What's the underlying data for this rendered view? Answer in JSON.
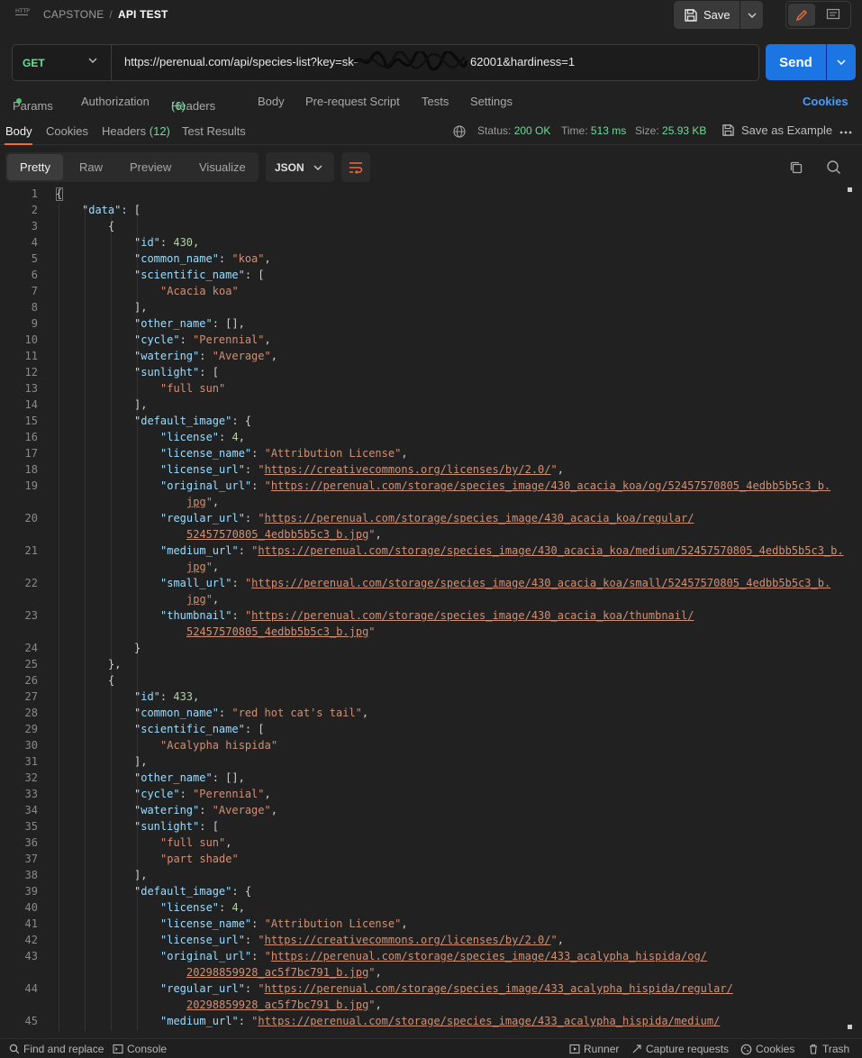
{
  "header": {
    "app_icon": "http-file-icon",
    "app_icon_text": "HTTP",
    "breadcrumb_collection": "CAPSTONE",
    "breadcrumb_separator": "/",
    "breadcrumb_request": "API TEST",
    "save_label": "Save"
  },
  "request": {
    "method": "GET",
    "url": "https://perenual.com/api/species-list?key=sk-",
    "url_tail": "62001&hardiness=1",
    "send_label": "Send"
  },
  "request_tabs": {
    "params": "Params",
    "authorization": "Authorization",
    "headers": "Headers",
    "headers_count": "(6)",
    "body": "Body",
    "prerequest": "Pre-request Script",
    "tests": "Tests",
    "settings": "Settings",
    "cookies": "Cookies"
  },
  "response_tabs": {
    "body": "Body",
    "cookies": "Cookies",
    "headers": "Headers",
    "headers_count": "(12)",
    "test_results": "Test Results"
  },
  "response_meta": {
    "status_label": "Status:",
    "status_value": "200 OK",
    "time_label": "Time:",
    "time_value": "513 ms",
    "size_label": "Size:",
    "size_value": "25.93 KB",
    "save_example": "Save as Example"
  },
  "viewer": {
    "modes": [
      "Pretty",
      "Raw",
      "Preview",
      "Visualize"
    ],
    "format": "JSON"
  },
  "code_lines": [
    {
      "n": "1",
      "indent": 0,
      "parts": [
        [
          "p",
          "{"
        ]
      ]
    },
    {
      "n": "2",
      "indent": 1,
      "parts": [
        [
          "k",
          "\"data\""
        ],
        [
          "p",
          ": ["
        ]
      ]
    },
    {
      "n": "3",
      "indent": 2,
      "parts": [
        [
          "p",
          "{"
        ]
      ]
    },
    {
      "n": "4",
      "indent": 3,
      "parts": [
        [
          "k",
          "\"id\""
        ],
        [
          "p",
          ": "
        ],
        [
          "n",
          "430"
        ],
        [
          "p",
          ","
        ]
      ]
    },
    {
      "n": "5",
      "indent": 3,
      "parts": [
        [
          "k",
          "\"common_name\""
        ],
        [
          "p",
          ": "
        ],
        [
          "s",
          "\"koa\""
        ],
        [
          "p",
          ","
        ]
      ]
    },
    {
      "n": "6",
      "indent": 3,
      "parts": [
        [
          "k",
          "\"scientific_name\""
        ],
        [
          "p",
          ": ["
        ]
      ]
    },
    {
      "n": "7",
      "indent": 4,
      "parts": [
        [
          "s",
          "\"Acacia koa\""
        ]
      ]
    },
    {
      "n": "8",
      "indent": 3,
      "parts": [
        [
          "p",
          "],"
        ]
      ]
    },
    {
      "n": "9",
      "indent": 3,
      "parts": [
        [
          "k",
          "\"other_name\""
        ],
        [
          "p",
          ": [],"
        ]
      ]
    },
    {
      "n": "10",
      "indent": 3,
      "parts": [
        [
          "k",
          "\"cycle\""
        ],
        [
          "p",
          ": "
        ],
        [
          "s",
          "\"Perennial\""
        ],
        [
          "p",
          ","
        ]
      ]
    },
    {
      "n": "11",
      "indent": 3,
      "parts": [
        [
          "k",
          "\"watering\""
        ],
        [
          "p",
          ": "
        ],
        [
          "s",
          "\"Average\""
        ],
        [
          "p",
          ","
        ]
      ]
    },
    {
      "n": "12",
      "indent": 3,
      "parts": [
        [
          "k",
          "\"sunlight\""
        ],
        [
          "p",
          ": ["
        ]
      ]
    },
    {
      "n": "13",
      "indent": 4,
      "parts": [
        [
          "s",
          "\"full sun\""
        ]
      ]
    },
    {
      "n": "14",
      "indent": 3,
      "parts": [
        [
          "p",
          "],"
        ]
      ]
    },
    {
      "n": "15",
      "indent": 3,
      "parts": [
        [
          "k",
          "\"default_image\""
        ],
        [
          "p",
          ": {"
        ]
      ]
    },
    {
      "n": "16",
      "indent": 4,
      "parts": [
        [
          "k",
          "\"license\""
        ],
        [
          "p",
          ": "
        ],
        [
          "n",
          "4"
        ],
        [
          "p",
          ","
        ]
      ]
    },
    {
      "n": "17",
      "indent": 4,
      "parts": [
        [
          "k",
          "\"license_name\""
        ],
        [
          "p",
          ": "
        ],
        [
          "s",
          "\"Attribution License\""
        ],
        [
          "p",
          ","
        ]
      ]
    },
    {
      "n": "18",
      "indent": 4,
      "parts": [
        [
          "k",
          "\"license_url\""
        ],
        [
          "p",
          ": "
        ],
        [
          "s",
          "\""
        ],
        [
          "u",
          "https://creativecommons.org/licenses/by/2.0/"
        ],
        [
          "s",
          "\""
        ],
        [
          "p",
          ","
        ]
      ]
    },
    {
      "n": "19",
      "indent": 4,
      "parts": [
        [
          "k",
          "\"original_url\""
        ],
        [
          "p",
          ": "
        ],
        [
          "s",
          "\""
        ],
        [
          "u",
          "https://perenual.com/storage/species_image/430_acacia_koa/og/52457570805_4edbb5b5c3_b."
        ]
      ]
    },
    {
      "n": "",
      "indent": 5,
      "parts": [
        [
          "u",
          "jpg"
        ],
        [
          "s",
          "\""
        ],
        [
          "p",
          ","
        ]
      ]
    },
    {
      "n": "20",
      "indent": 4,
      "parts": [
        [
          "k",
          "\"regular_url\""
        ],
        [
          "p",
          ": "
        ],
        [
          "s",
          "\""
        ],
        [
          "u",
          "https://perenual.com/storage/species_image/430_acacia_koa/regular/"
        ]
      ]
    },
    {
      "n": "",
      "indent": 5,
      "parts": [
        [
          "u",
          "52457570805_4edbb5b5c3_b.jpg"
        ],
        [
          "s",
          "\""
        ],
        [
          "p",
          ","
        ]
      ]
    },
    {
      "n": "21",
      "indent": 4,
      "parts": [
        [
          "k",
          "\"medium_url\""
        ],
        [
          "p",
          ": "
        ],
        [
          "s",
          "\""
        ],
        [
          "u",
          "https://perenual.com/storage/species_image/430_acacia_koa/medium/52457570805_4edbb5b5c3_b."
        ]
      ]
    },
    {
      "n": "",
      "indent": 5,
      "parts": [
        [
          "u",
          "jpg"
        ],
        [
          "s",
          "\""
        ],
        [
          "p",
          ","
        ]
      ]
    },
    {
      "n": "22",
      "indent": 4,
      "parts": [
        [
          "k",
          "\"small_url\""
        ],
        [
          "p",
          ": "
        ],
        [
          "s",
          "\""
        ],
        [
          "u",
          "https://perenual.com/storage/species_image/430_acacia_koa/small/52457570805_4edbb5b5c3_b."
        ]
      ]
    },
    {
      "n": "",
      "indent": 5,
      "parts": [
        [
          "u",
          "jpg"
        ],
        [
          "s",
          "\""
        ],
        [
          "p",
          ","
        ]
      ]
    },
    {
      "n": "23",
      "indent": 4,
      "parts": [
        [
          "k",
          "\"thumbnail\""
        ],
        [
          "p",
          ": "
        ],
        [
          "s",
          "\""
        ],
        [
          "u",
          "https://perenual.com/storage/species_image/430_acacia_koa/thumbnail/"
        ]
      ]
    },
    {
      "n": "",
      "indent": 5,
      "parts": [
        [
          "u",
          "52457570805_4edbb5b5c3_b.jpg"
        ],
        [
          "s",
          "\""
        ]
      ]
    },
    {
      "n": "24",
      "indent": 3,
      "parts": [
        [
          "p",
          "}"
        ]
      ]
    },
    {
      "n": "25",
      "indent": 2,
      "parts": [
        [
          "p",
          "},"
        ]
      ]
    },
    {
      "n": "26",
      "indent": 2,
      "parts": [
        [
          "p",
          "{"
        ]
      ]
    },
    {
      "n": "27",
      "indent": 3,
      "parts": [
        [
          "k",
          "\"id\""
        ],
        [
          "p",
          ": "
        ],
        [
          "n",
          "433"
        ],
        [
          "p",
          ","
        ]
      ]
    },
    {
      "n": "28",
      "indent": 3,
      "parts": [
        [
          "k",
          "\"common_name\""
        ],
        [
          "p",
          ": "
        ],
        [
          "s",
          "\"red hot cat's tail\""
        ],
        [
          "p",
          ","
        ]
      ]
    },
    {
      "n": "29",
      "indent": 3,
      "parts": [
        [
          "k",
          "\"scientific_name\""
        ],
        [
          "p",
          ": ["
        ]
      ]
    },
    {
      "n": "30",
      "indent": 4,
      "parts": [
        [
          "s",
          "\"Acalypha hispida\""
        ]
      ]
    },
    {
      "n": "31",
      "indent": 3,
      "parts": [
        [
          "p",
          "],"
        ]
      ]
    },
    {
      "n": "32",
      "indent": 3,
      "parts": [
        [
          "k",
          "\"other_name\""
        ],
        [
          "p",
          ": [],"
        ]
      ]
    },
    {
      "n": "33",
      "indent": 3,
      "parts": [
        [
          "k",
          "\"cycle\""
        ],
        [
          "p",
          ": "
        ],
        [
          "s",
          "\"Perennial\""
        ],
        [
          "p",
          ","
        ]
      ]
    },
    {
      "n": "34",
      "indent": 3,
      "parts": [
        [
          "k",
          "\"watering\""
        ],
        [
          "p",
          ": "
        ],
        [
          "s",
          "\"Average\""
        ],
        [
          "p",
          ","
        ]
      ]
    },
    {
      "n": "35",
      "indent": 3,
      "parts": [
        [
          "k",
          "\"sunlight\""
        ],
        [
          "p",
          ": ["
        ]
      ]
    },
    {
      "n": "36",
      "indent": 4,
      "parts": [
        [
          "s",
          "\"full sun\""
        ],
        [
          "p",
          ","
        ]
      ]
    },
    {
      "n": "37",
      "indent": 4,
      "parts": [
        [
          "s",
          "\"part shade\""
        ]
      ]
    },
    {
      "n": "38",
      "indent": 3,
      "parts": [
        [
          "p",
          "],"
        ]
      ]
    },
    {
      "n": "39",
      "indent": 3,
      "parts": [
        [
          "k",
          "\"default_image\""
        ],
        [
          "p",
          ": {"
        ]
      ]
    },
    {
      "n": "40",
      "indent": 4,
      "parts": [
        [
          "k",
          "\"license\""
        ],
        [
          "p",
          ": "
        ],
        [
          "n",
          "4"
        ],
        [
          "p",
          ","
        ]
      ]
    },
    {
      "n": "41",
      "indent": 4,
      "parts": [
        [
          "k",
          "\"license_name\""
        ],
        [
          "p",
          ": "
        ],
        [
          "s",
          "\"Attribution License\""
        ],
        [
          "p",
          ","
        ]
      ]
    },
    {
      "n": "42",
      "indent": 4,
      "parts": [
        [
          "k",
          "\"license_url\""
        ],
        [
          "p",
          ": "
        ],
        [
          "s",
          "\""
        ],
        [
          "u",
          "https://creativecommons.org/licenses/by/2.0/"
        ],
        [
          "s",
          "\""
        ],
        [
          "p",
          ","
        ]
      ]
    },
    {
      "n": "43",
      "indent": 4,
      "parts": [
        [
          "k",
          "\"original_url\""
        ],
        [
          "p",
          ": "
        ],
        [
          "s",
          "\""
        ],
        [
          "u",
          "https://perenual.com/storage/species_image/433_acalypha_hispida/og/"
        ]
      ]
    },
    {
      "n": "",
      "indent": 5,
      "parts": [
        [
          "u",
          "20298859928_ac5f7bc791_b.jpg"
        ],
        [
          "s",
          "\""
        ],
        [
          "p",
          ","
        ]
      ]
    },
    {
      "n": "44",
      "indent": 4,
      "parts": [
        [
          "k",
          "\"regular_url\""
        ],
        [
          "p",
          ": "
        ],
        [
          "s",
          "\""
        ],
        [
          "u",
          "https://perenual.com/storage/species_image/433_acalypha_hispida/regular/"
        ]
      ]
    },
    {
      "n": "",
      "indent": 5,
      "parts": [
        [
          "u",
          "20298859928_ac5f7bc791_b.jpg"
        ],
        [
          "s",
          "\""
        ],
        [
          "p",
          ","
        ]
      ]
    },
    {
      "n": "45",
      "indent": 4,
      "parts": [
        [
          "k",
          "\"medium_url\""
        ],
        [
          "p",
          ": "
        ],
        [
          "s",
          "\""
        ],
        [
          "u",
          "https://perenual.com/storage/species_image/433_acalypha_hispida/medium/"
        ]
      ]
    }
  ],
  "footer": {
    "find_replace": "Find and replace",
    "console": "Console",
    "runner": "Runner",
    "capture": "Capture requests",
    "cookies": "Cookies",
    "trash": "Trash"
  },
  "colors": {
    "accent_blue": "#1b76e3",
    "method_green": "#6bdd9a",
    "tab_underline": "#f26b3a",
    "json_key": "#9cdcfe",
    "json_string": "#ce9178",
    "json_number": "#b5cea8"
  }
}
